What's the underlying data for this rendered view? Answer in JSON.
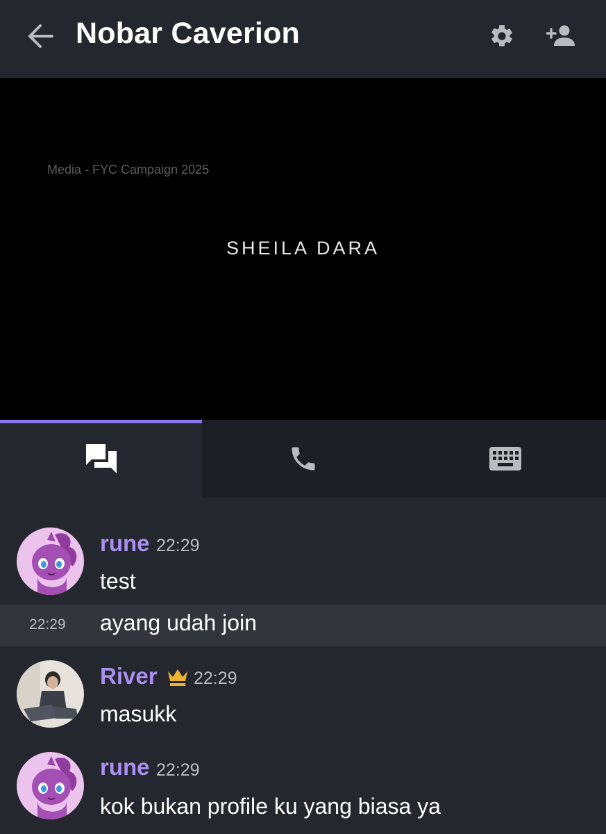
{
  "header": {
    "title": "Nobar Caverion"
  },
  "video": {
    "caption": "Media - FYC Campaign 2025",
    "name": "SHEILA DARA"
  },
  "tabs": [
    {
      "name": "chat",
      "icon": "chat-icon",
      "active": true
    },
    {
      "name": "call",
      "icon": "phone-icon",
      "active": false
    },
    {
      "name": "keyboard",
      "icon": "keyboard-icon",
      "active": false
    }
  ],
  "messages": [
    {
      "user": "rune",
      "time": "22:29",
      "text": "test"
    },
    {
      "time": "22:29",
      "text": "ayang udah join"
    },
    {
      "user": "River",
      "time": "22:29",
      "text": "masukk",
      "badge": "crown-icon"
    },
    {
      "user": "rune",
      "time": "22:29",
      "text": "kok bukan profile ku yang biasa ya"
    }
  ],
  "colors": {
    "background": "#25272e",
    "accent": "#8a74f0",
    "username": "#a98ff0",
    "crown": "#f0b232"
  }
}
